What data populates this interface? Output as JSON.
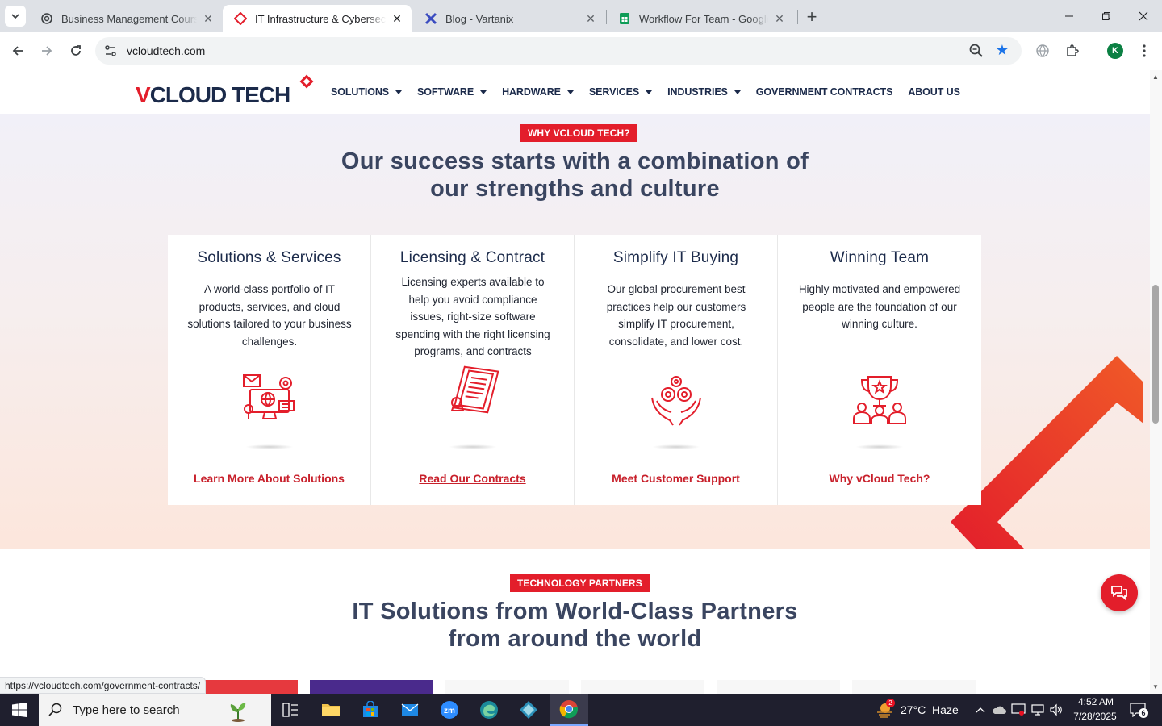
{
  "browser": {
    "tabs": [
      {
        "title": "Business Management Coursew",
        "active": false
      },
      {
        "title": "IT Infrastructure & Cybersecurit",
        "active": true
      },
      {
        "title": "Blog - Vartanix",
        "active": false
      },
      {
        "title": "Workflow For Team - Google Sh",
        "active": false
      }
    ],
    "url": "vcloudtech.com",
    "profile_initial": "K",
    "status_url": "https://vcloudtech.com/government-contracts/"
  },
  "site": {
    "logo_text": "CLOUD TECH",
    "logo_v": "V",
    "nav": [
      {
        "label": "SOLUTIONS",
        "dropdown": true
      },
      {
        "label": "SOFTWARE",
        "dropdown": true
      },
      {
        "label": "HARDWARE",
        "dropdown": true
      },
      {
        "label": "SERVICES",
        "dropdown": true
      },
      {
        "label": "INDUSTRIES",
        "dropdown": true
      },
      {
        "label": "GOVERNMENT CONTRACTS",
        "dropdown": false
      },
      {
        "label": "ABOUT US",
        "dropdown": false
      }
    ],
    "why": {
      "pill": "WHY VCLOUD TECH?",
      "title_line1": "Our success starts with a combination of",
      "title_line2": "our strengths and culture",
      "cards": [
        {
          "title": "Solutions & Services",
          "desc": "A world-class portfolio of IT products, services, and cloud solutions tailored to your business challenges.",
          "link": "Learn More About Solutions",
          "icon": "it-solutions-icon"
        },
        {
          "title": "Licensing & Contract",
          "desc": "Licensing experts available to help you avoid compliance issues, right-size software spending with the right licensing programs, and contracts",
          "link": "Read Our Contracts",
          "icon": "contract-document-icon"
        },
        {
          "title": "Simplify IT Buying",
          "desc": "Our global procurement best practices help our customers simplify IT procurement, consolidate, and lower cost.",
          "link": "Meet Customer Support",
          "icon": "gears-in-hands-icon"
        },
        {
          "title": "Winning Team",
          "desc": "Highly motivated and empowered people are the foundation of our winning culture.",
          "link": "Why vCloud Tech?",
          "icon": "trophy-team-icon"
        }
      ]
    },
    "partners": {
      "pill": "TECHNOLOGY PARTNERS",
      "title_line1": "IT Solutions from World-Class Partners",
      "title_line2": "from around the world"
    }
  },
  "taskbar": {
    "search_placeholder": "Type here to search",
    "weather": "27°C  Haze",
    "weather_badge": "2",
    "time": "4:52 AM",
    "date": "7/28/2025",
    "notifications": "6"
  },
  "colors": {
    "brand_red": "#e31e2b",
    "navy": "#1b2a4a"
  }
}
